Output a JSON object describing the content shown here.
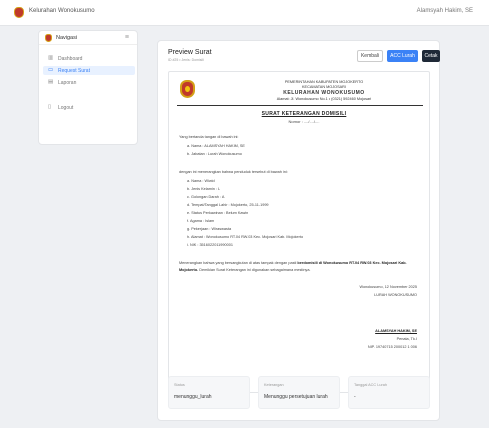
{
  "app": {
    "title": "Kelurahan Wonokusumo",
    "user": "Alamsyah Hakim, SE"
  },
  "sidebar": {
    "title": "Navigasi",
    "toggle": "≡",
    "items": [
      {
        "label": "Dashboard",
        "icon": "▥"
      },
      {
        "label": "Request Surat",
        "icon": "▭"
      },
      {
        "label": "Laporan",
        "icon": "▤"
      },
      {
        "label": "Logout",
        "icon": "▯"
      }
    ]
  },
  "header": {
    "title": "Preview Surat",
    "subtitle": "ID #25 • Jenis: Domisili",
    "back_label": "Kembali",
    "acc_label": "ACC Lurah",
    "print_label": "Cetak"
  },
  "letter": {
    "kop": [
      "PEMERINTAHAN KABUPATEN MOJOKERTO",
      "KECAMATAN MOJOSARI",
      "KELURAHAN WONOKUSUMO",
      "Alamat: Jl. Wonokusumo No.1 • (0321) 592460 Mojosari"
    ],
    "title": "SURAT KETERANGAN DOMISILI",
    "number": "Nomor : ..../..../....",
    "intro": "Yang bertanda tangan di bawah ini:",
    "signer": [
      "a.   Nama : ALAMSYAH HAKIM, SE",
      "b.   Jabatan : Lurah Wonokusumo"
    ],
    "statement": "dengan ini menerangkan bahwa penduduk tersebut di bawah ini:",
    "resident": [
      "a.   Nama : Wiwid",
      "b.   Jenis Kelamin : L",
      "c.   Golongan Darah : A",
      "d.   Tempat/Tanggal Lahir : Mojokerto, 25-11-1999",
      "e.   Status Perkawinan : Belum Kawin",
      "f.   Agama : Islam",
      "g.   Pekerjaan : Wiraswasta",
      "h.   Alamat : Wonokusumo RT.04 RW.03 Kec. Mojosari Kab. Mojokerto",
      "i.   NIK : 3516022011990001"
    ],
    "closing_a": "Menerangkan bahwa yang bersangkutan di atas tampak dengan pasti ",
    "closing_b": "berdomisili di Wonokusumo RT.04 RW.03 Kec. Mojosari Kab. Mojokerto.",
    "closing_c": " Demikian Surat Keterangan ini digunakan sebagaimana mestinya.",
    "place_date": "Wonokusumo, 12 November 2025",
    "position": "LURAH WONOKUSUMO",
    "sign_name": "ALAMSYAH HAKIM, SE",
    "rank": "Penata, Tk.I",
    "nip": "NIP. 19740715 200012 1 006"
  },
  "status": [
    {
      "key": "Status",
      "value": "menunggu_lurah"
    },
    {
      "key": "Keterangan",
      "value": "Menunggu persetujuan lurah"
    },
    {
      "key": "Tanggal ACC Lurah",
      "value": "-"
    }
  ],
  "colors": {
    "accent": "#3b82f6",
    "dark": "#1f2937",
    "seal": "#c0392b",
    "gold": "#d4a017"
  }
}
